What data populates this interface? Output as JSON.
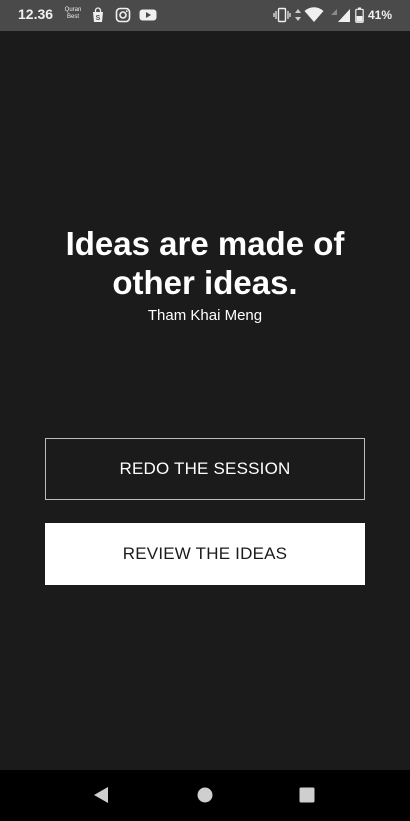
{
  "status_bar": {
    "time": "12.36",
    "quran_label_line1": "Quran",
    "quran_label_line2": "Best",
    "battery": "41%",
    "icons": [
      "quran-icon",
      "shopping-bag-icon",
      "instagram-icon",
      "youtube-icon",
      "vibrate-icon",
      "data-arrows-icon",
      "wifi-icon",
      "signal-icon",
      "signal-icon-2",
      "battery-icon"
    ]
  },
  "quote": {
    "text": "Ideas are made of other ideas.",
    "author": "Tham Khai Meng"
  },
  "actions": {
    "redo_label": "REDO THE SESSION",
    "review_label": "REVIEW THE IDEAS"
  },
  "nav": {
    "icons": [
      "back-icon",
      "home-icon",
      "recents-icon"
    ]
  },
  "colors": {
    "background": "#1b1b1b",
    "status_bar": "#4a4a4a",
    "nav_bar": "#000000",
    "primary_button_bg": "#ffffff",
    "outline_border": "#bdbdbd"
  }
}
